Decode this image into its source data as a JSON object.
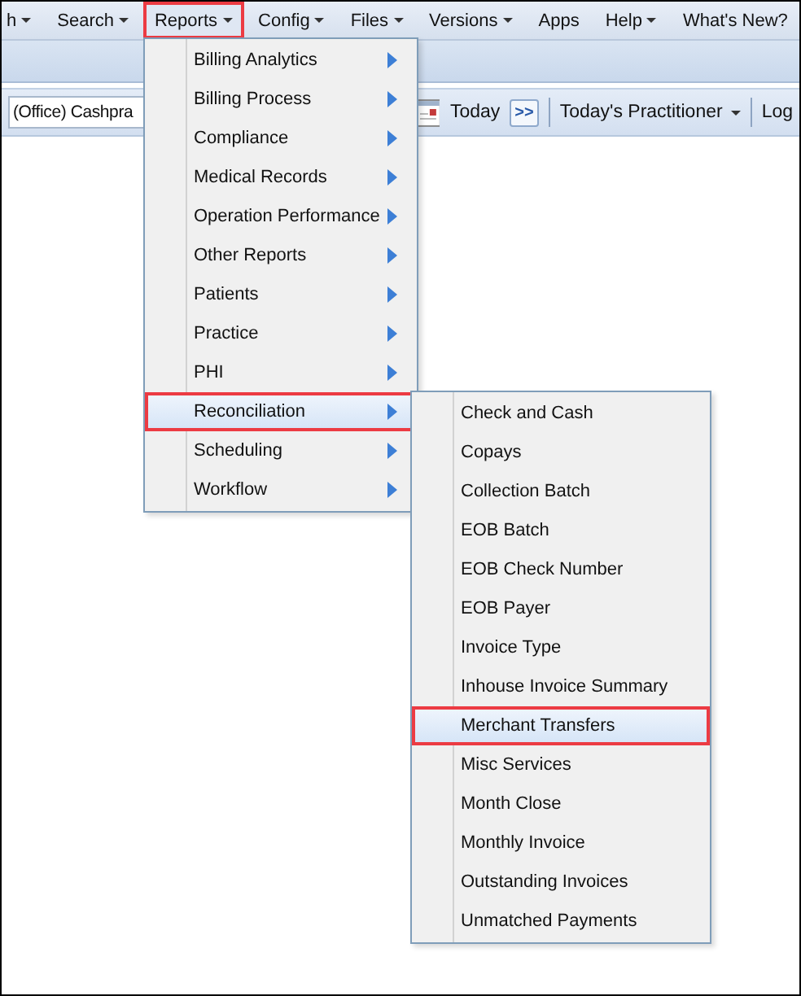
{
  "menu_bar": [
    {
      "label": "h",
      "has_caret": true,
      "selected": false
    },
    {
      "label": "Search",
      "has_caret": true,
      "selected": false
    },
    {
      "label": "Reports",
      "has_caret": true,
      "selected": true
    },
    {
      "label": "Config",
      "has_caret": true,
      "selected": false
    },
    {
      "label": "Files",
      "has_caret": true,
      "selected": false
    },
    {
      "label": "Versions",
      "has_caret": true,
      "selected": false
    },
    {
      "label": "Apps",
      "has_caret": false,
      "selected": false
    },
    {
      "label": "Help",
      "has_caret": true,
      "selected": false
    },
    {
      "label": "What's New?",
      "has_caret": false,
      "selected": false
    }
  ],
  "toolbar": {
    "office_field": {
      "value": "(Office) Cashpra"
    },
    "today_button": "Today",
    "next_button": ">>",
    "practitioner": {
      "label": "Today's Practitioner",
      "has_caret": true
    },
    "log": "Log"
  },
  "reports_menu": {
    "items": [
      {
        "label": "Billing Analytics",
        "has_submenu": true,
        "selected": false
      },
      {
        "label": "Billing Process",
        "has_submenu": true,
        "selected": false
      },
      {
        "label": "Compliance",
        "has_submenu": true,
        "selected": false
      },
      {
        "label": "Medical Records",
        "has_submenu": true,
        "selected": false
      },
      {
        "label": "Operation Performance",
        "has_submenu": true,
        "selected": false
      },
      {
        "label": "Other Reports",
        "has_submenu": true,
        "selected": false
      },
      {
        "label": "Patients",
        "has_submenu": true,
        "selected": false
      },
      {
        "label": "Practice",
        "has_submenu": true,
        "selected": false
      },
      {
        "label": "PHI",
        "has_submenu": true,
        "selected": false
      },
      {
        "label": "Reconciliation",
        "has_submenu": true,
        "selected": true
      },
      {
        "label": "Scheduling",
        "has_submenu": true,
        "selected": false
      },
      {
        "label": "Workflow",
        "has_submenu": true,
        "selected": false
      }
    ]
  },
  "reconciliation_submenu": {
    "items": [
      {
        "label": "Check and Cash",
        "selected": false
      },
      {
        "label": "Copays",
        "selected": false
      },
      {
        "label": "Collection Batch",
        "selected": false
      },
      {
        "label": "EOB Batch",
        "selected": false
      },
      {
        "label": "EOB Check Number",
        "selected": false
      },
      {
        "label": "EOB Payer",
        "selected": false
      },
      {
        "label": "Invoice Type",
        "selected": false
      },
      {
        "label": "Inhouse Invoice Summary",
        "selected": false
      },
      {
        "label": "Merchant Transfers",
        "selected": true
      },
      {
        "label": "Misc Services",
        "selected": false
      },
      {
        "label": "Month Close",
        "selected": false
      },
      {
        "label": "Monthly Invoice",
        "selected": false
      },
      {
        "label": "Outstanding Invoices",
        "selected": false
      },
      {
        "label": "Unmatched Payments",
        "selected": false
      }
    ]
  }
}
